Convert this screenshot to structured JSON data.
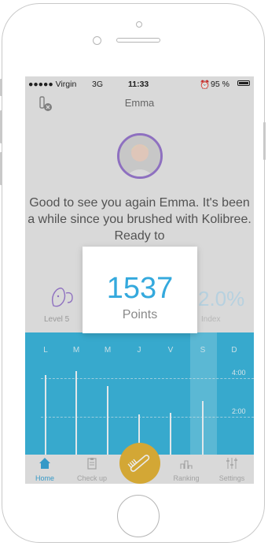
{
  "status_bar": {
    "carrier": "●●●●● Virgin",
    "network": "3G",
    "time": "11:33",
    "battery": "95 %"
  },
  "nav": {
    "title": "Emma"
  },
  "greeting": "Good to see you again Emma. It's been a while since you brushed with Kolibree. Ready to",
  "stats": {
    "level_label": "Level 5",
    "index_value": "2.0%",
    "index_label": "Index"
  },
  "chart_data": {
    "type": "bar",
    "categories": [
      "L",
      "M",
      "M",
      "J",
      "V",
      "S",
      "D"
    ],
    "values": [
      4.2,
      4.4,
      3.6,
      2.1,
      2.2,
      2.8,
      0
    ],
    "y_ticks": [
      "4:00",
      "2:00"
    ],
    "ylim": [
      0,
      6
    ],
    "selected_category": "S",
    "grid": "dashed"
  },
  "popup": {
    "value": "1537",
    "label": "Points"
  },
  "tabs": [
    {
      "label": "Home",
      "icon": "home-icon",
      "active": true
    },
    {
      "label": "Check up",
      "icon": "clipboard-icon",
      "active": false
    },
    {
      "label": "Ranking",
      "icon": "ranking-icon",
      "active": false
    },
    {
      "label": "Settings",
      "icon": "settings-icon",
      "active": false
    }
  ],
  "colors": {
    "accent": "#34a9dd",
    "chart_bg": "#3cb8df",
    "brush_button": "#e5b63a",
    "avatar_ring": "#9b7ad1"
  }
}
